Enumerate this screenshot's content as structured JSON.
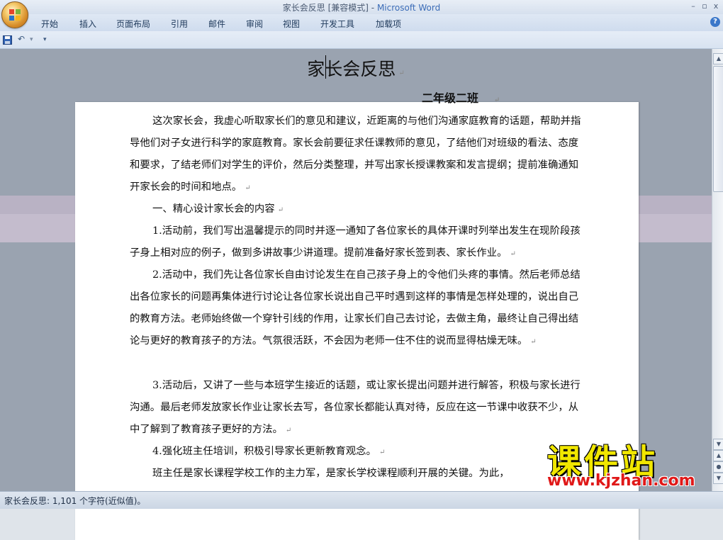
{
  "window": {
    "title_doc": "家长会反思 [兼容模式]",
    "title_sep": " - ",
    "title_app": "Microsoft Word",
    "minimize_icon": "–",
    "restore_icon": "▫",
    "close_icon": "x"
  },
  "ribbon": {
    "tabs": [
      "开始",
      "插入",
      "页面布局",
      "引用",
      "邮件",
      "审阅",
      "视图",
      "开发工具",
      "加载项"
    ],
    "help": "?"
  },
  "qat": {
    "save_icon": "save-icon",
    "undo_icon": "undo-icon",
    "undo_arrow": "↶",
    "dropdown_arrow": "▾",
    "customize_arrow": "▾"
  },
  "document": {
    "title": "家长会反思",
    "subtitle": "二年级二班",
    "paragraphs": [
      "这次家长会，我虚心听取家长们的意见和建议，近距离的与他们沟通家庭教育的话题，帮助并指导他们对子女进行科学的家庭教育。家长会前要征求任课教师的意见，了结他们对班级的看法、态度和要求，了结老师们对学生的评价，然后分类整理，并写出家长授课教案和发言提纲；提前准确通知开家长会的时间和地点。",
      "一、精心设计家长会的内容",
      "1.活动前，我们写出温馨提示的同时并逐一通知了各位家长的具体开课时列举出发生在现阶段孩子身上相对应的例子，做到多讲故事少讲道理。提前准备好家长签到表、家长作业。",
      "2.活动中，我们先让各位家长自由讨论发生在自己孩子身上的令他们头疼的事情。然后老师总结出各位家长的问题再集体进行讨论让各位家长说出自己平时遇到这样的事情是怎样处理的，说出自己的教育方法。老师始终做一个穿针引线的作用，让家长们自己去讨论，去做主角，最终让自己得出结论与更好的教育孩子的方法。气氛很活跃，不会因为老师一住不住的说而显得枯燥无味。",
      "3.活动后，又讲了一些与本班学生接近的话题，或让家长提出问题并进行解答，积极与家长进行沟通。最后老师发放家长作业让家长去写，各位家长都能认真对待，反应在这一节课中收获不少，从中了解到了教育孩子更好的方法。",
      "4.强化班主任培训，积极引导家长更新教育观念。",
      "班主任是家长课程学校工作的主力军，是家长学校课程顺利开展的关键。为此，"
    ],
    "paragraph_mark": "↵"
  },
  "scrollbar": {
    "up_arrow": "▲",
    "down_arrow": "▼",
    "prev_page": "▲",
    "select_browse": "●",
    "next_page": "▼"
  },
  "status": {
    "text": "家长会反思: 1,101 个字符(近似值)。"
  },
  "watermark": {
    "big": "课件站",
    "url": "www.kjzhan.com"
  },
  "colors": {
    "title_app": "#3b6cb7",
    "watermark_big": "#f1e700",
    "watermark_url": "#e01818"
  }
}
